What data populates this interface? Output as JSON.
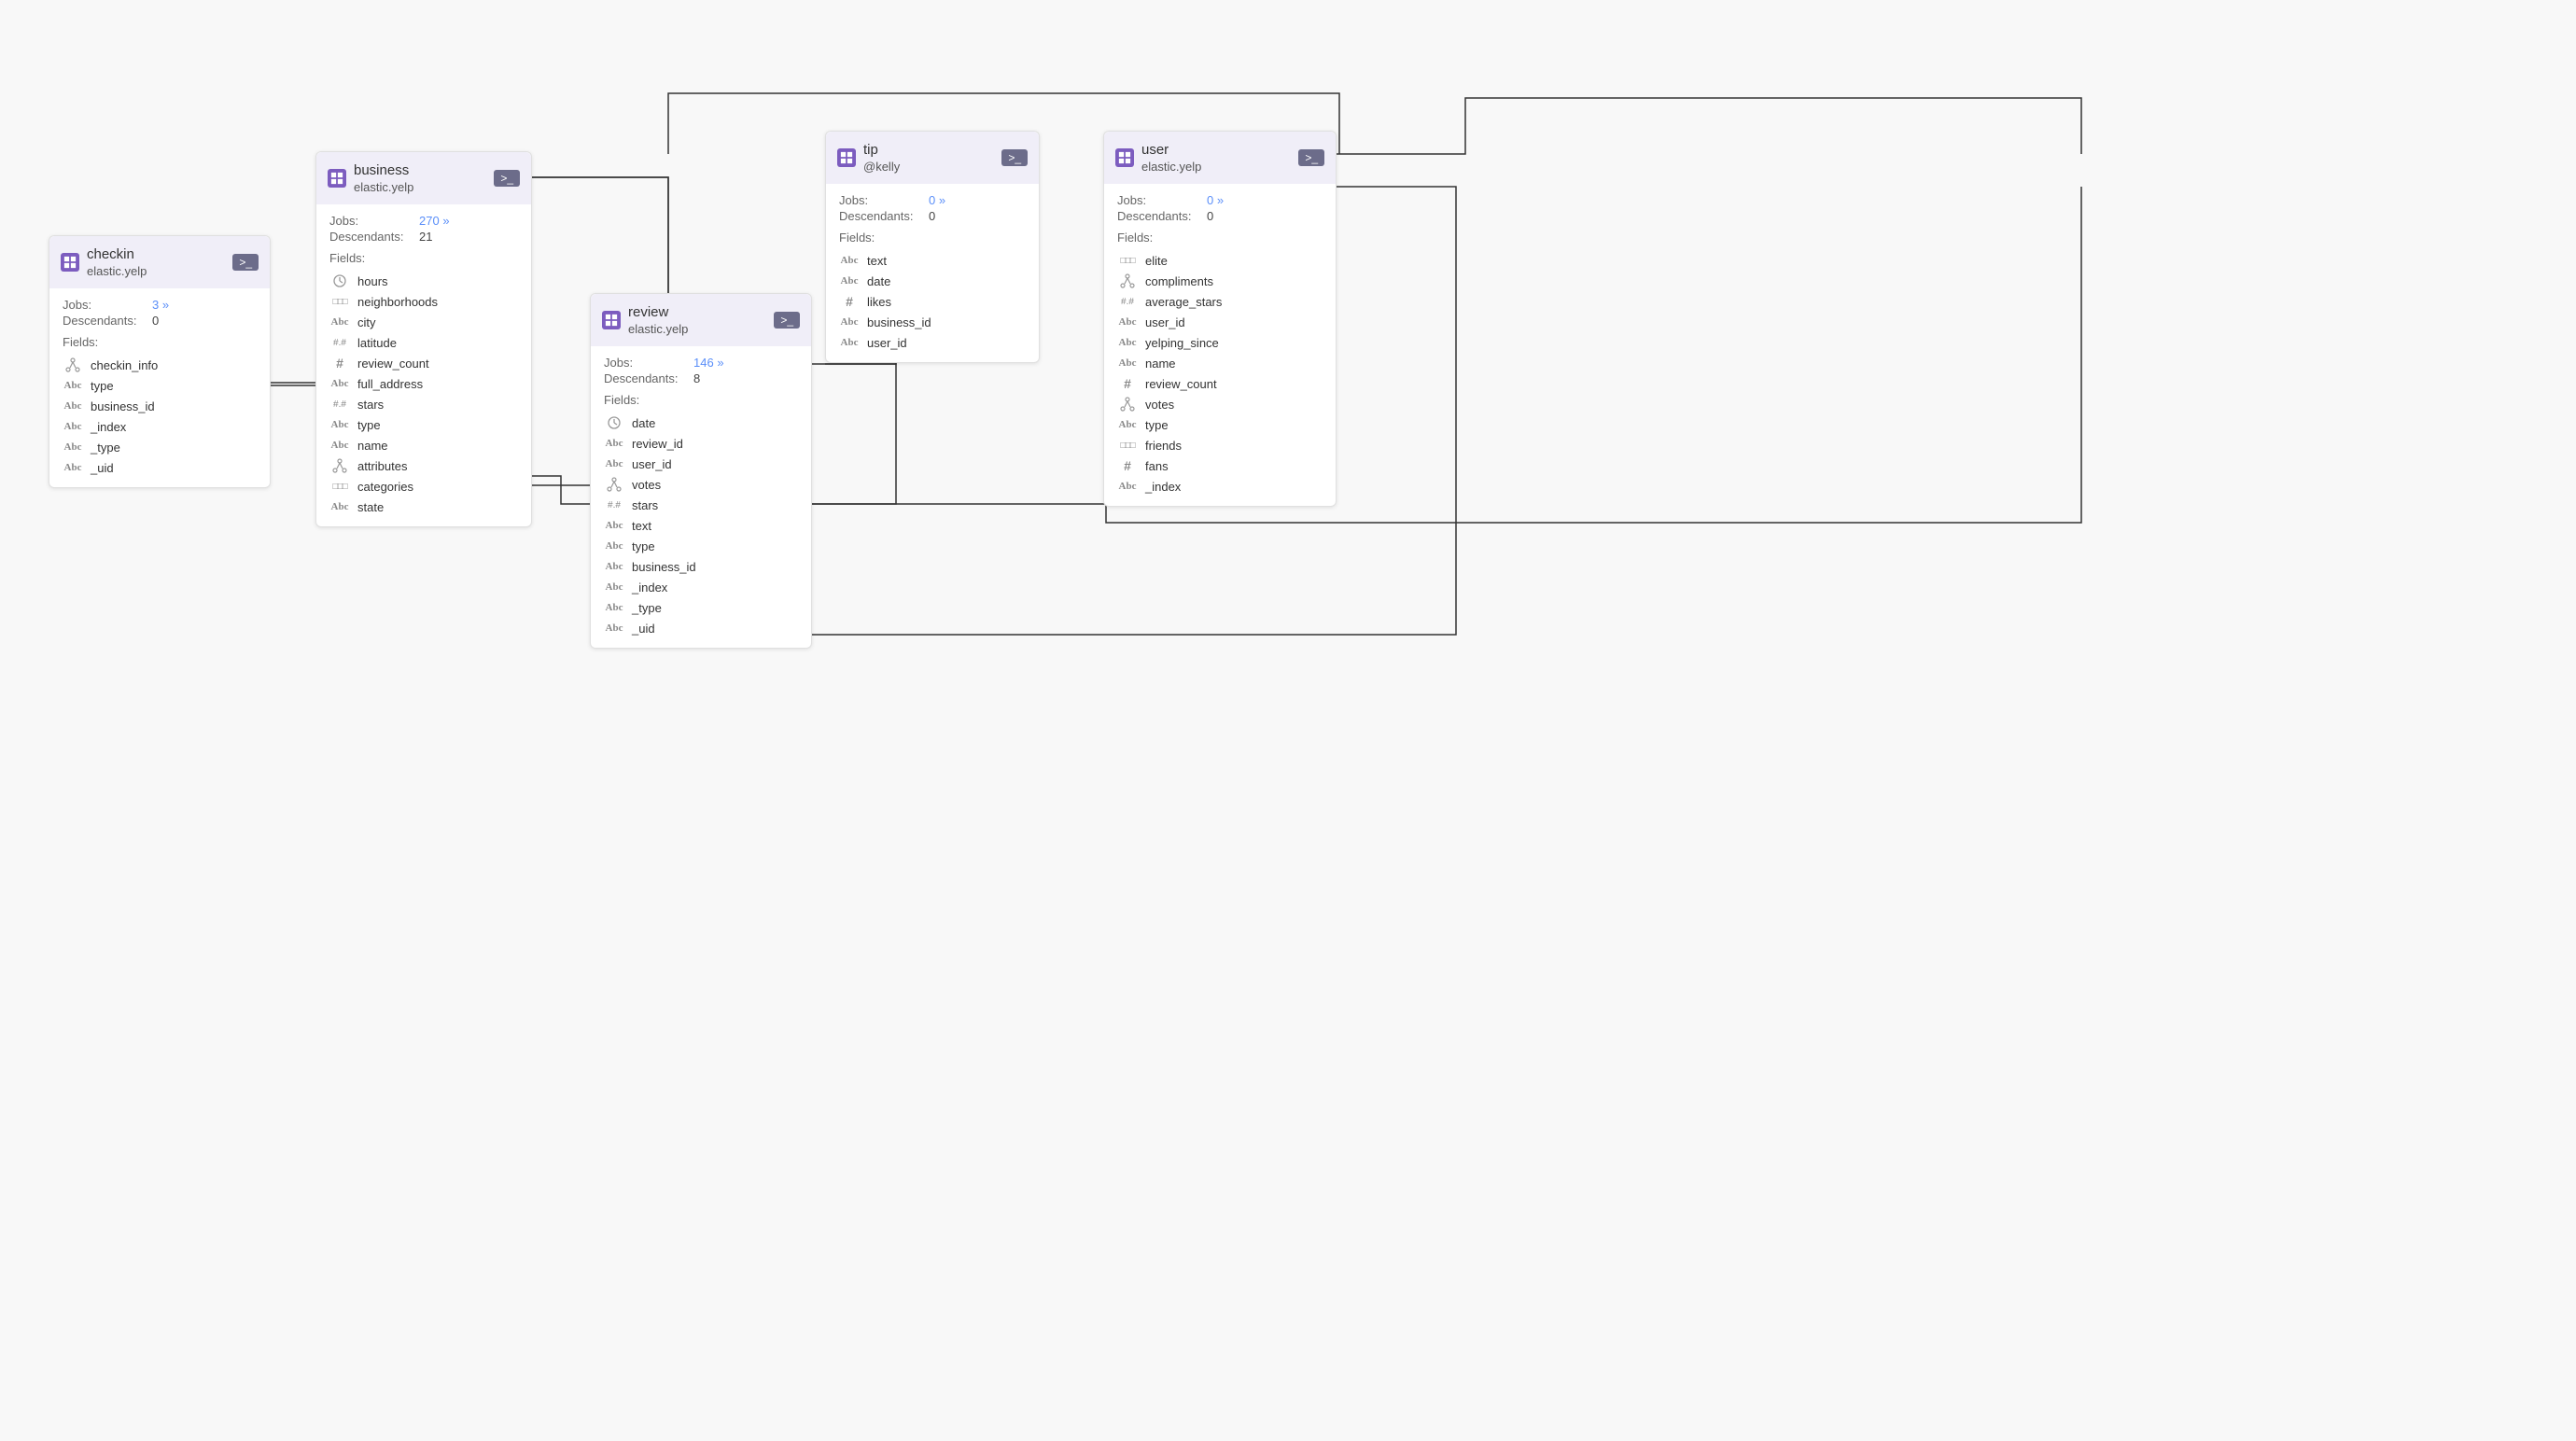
{
  "cards": {
    "checkin": {
      "title": "checkin",
      "subtitle": "elastic.yelp",
      "jobs_count": "3",
      "jobs_suffix": " »",
      "descendants": "0",
      "fields_label": "Fields:",
      "fields": [
        {
          "icon": "network",
          "name": "checkin_info"
        },
        {
          "icon": "abc",
          "name": "type"
        },
        {
          "icon": "abc",
          "name": "business_id"
        },
        {
          "icon": "abc",
          "name": "_index"
        },
        {
          "icon": "abc",
          "name": "_type"
        },
        {
          "icon": "abc",
          "name": "_uid"
        }
      ]
    },
    "business": {
      "title": "business",
      "subtitle": "elastic.yelp",
      "jobs_count": "270",
      "jobs_suffix": " »",
      "descendants": "21",
      "fields_label": "Fields:",
      "fields": [
        {
          "icon": "clock",
          "name": "hours"
        },
        {
          "icon": "dotdot",
          "name": "neighborhoods"
        },
        {
          "icon": "abc",
          "name": "city"
        },
        {
          "icon": "dothash",
          "name": "latitude"
        },
        {
          "icon": "hash",
          "name": "review_count"
        },
        {
          "icon": "abc",
          "name": "full_address"
        },
        {
          "icon": "dothash",
          "name": "stars"
        },
        {
          "icon": "abc",
          "name": "type"
        },
        {
          "icon": "abc",
          "name": "name"
        },
        {
          "icon": "network",
          "name": "attributes"
        },
        {
          "icon": "dotdot",
          "name": "categories"
        },
        {
          "icon": "abc",
          "name": "state"
        }
      ]
    },
    "review": {
      "title": "review",
      "subtitle": "elastic.yelp",
      "jobs_count": "146",
      "jobs_suffix": " »",
      "descendants": "8",
      "fields_label": "Fields:",
      "fields": [
        {
          "icon": "clock",
          "name": "date"
        },
        {
          "icon": "abc",
          "name": "review_id"
        },
        {
          "icon": "abc",
          "name": "user_id"
        },
        {
          "icon": "network",
          "name": "votes"
        },
        {
          "icon": "dothash",
          "name": "stars"
        },
        {
          "icon": "abc",
          "name": "text"
        },
        {
          "icon": "abc",
          "name": "type"
        },
        {
          "icon": "abc",
          "name": "business_id"
        },
        {
          "icon": "abc",
          "name": "_index"
        },
        {
          "icon": "abc",
          "name": "_type"
        },
        {
          "icon": "abc",
          "name": "_uid"
        }
      ]
    },
    "tip": {
      "title": "tip",
      "subtitle": "@kelly",
      "jobs_count": "0",
      "jobs_suffix": " »",
      "descendants": "0",
      "fields_label": "Fields:",
      "fields": [
        {
          "icon": "abc",
          "name": "text"
        },
        {
          "icon": "abc",
          "name": "date"
        },
        {
          "icon": "hash",
          "name": "likes"
        },
        {
          "icon": "abc",
          "name": "business_id"
        },
        {
          "icon": "abc",
          "name": "user_id"
        }
      ]
    },
    "user": {
      "title": "user",
      "subtitle": "elastic.yelp",
      "jobs_count": "0",
      "jobs_suffix": " »",
      "descendants": "0",
      "fields_label": "Fields:",
      "fields": [
        {
          "icon": "dotdot",
          "name": "elite"
        },
        {
          "icon": "network",
          "name": "compliments"
        },
        {
          "icon": "dothash",
          "name": "average_stars"
        },
        {
          "icon": "abc",
          "name": "user_id"
        },
        {
          "icon": "abc",
          "name": "yelping_since"
        },
        {
          "icon": "abc",
          "name": "name"
        },
        {
          "icon": "hash",
          "name": "review_count"
        },
        {
          "icon": "network",
          "name": "votes"
        },
        {
          "icon": "abc",
          "name": "type"
        },
        {
          "icon": "dotdot",
          "name": "friends"
        },
        {
          "icon": "hash",
          "name": "fans"
        },
        {
          "icon": "abc",
          "name": "_index"
        }
      ]
    }
  },
  "labels": {
    "jobs": "Jobs:",
    "descendants": "Descendants:",
    "cmd": ">_"
  }
}
